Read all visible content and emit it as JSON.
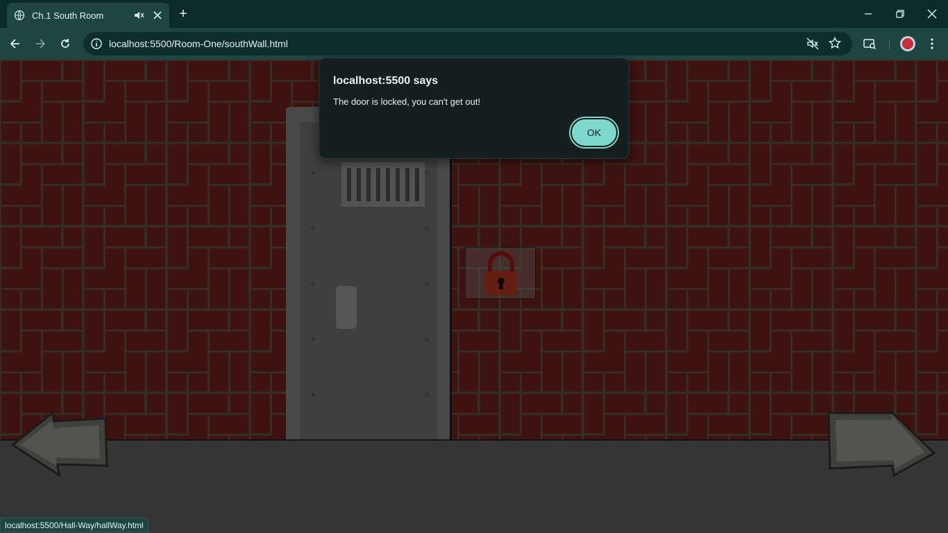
{
  "browser": {
    "tab_title": "Ch.1 South Room",
    "new_tab": "+",
    "url": "localhost:5500/Room-One/southWall.html"
  },
  "status_bar": {
    "hover_url": "localhost:5500/Hall-Way/hallWay.html"
  },
  "dialog": {
    "title": "localhost:5500 says",
    "message": "The door is locked, you can't get out!",
    "ok_label": "OK"
  },
  "colors": {
    "chrome_bg": "#1e4444",
    "dialog_bg": "#151f20",
    "ok_button": "#7ed8cd",
    "brick": "#6a1f1f",
    "mortar": "#5a4a3c"
  },
  "icons": {
    "tab": [
      "globe-icon",
      "mute-icon",
      "close-tab-icon"
    ],
    "toolbar": [
      "back-icon",
      "forward-icon",
      "reload-icon",
      "site-info-icon",
      "media-muted-icon",
      "bookmark-star-icon",
      "reading-mode-icon",
      "profile-avatar",
      "menu-icon"
    ],
    "page": [
      "padlock-icon",
      "left-arrow-icon",
      "right-arrow-icon"
    ]
  }
}
